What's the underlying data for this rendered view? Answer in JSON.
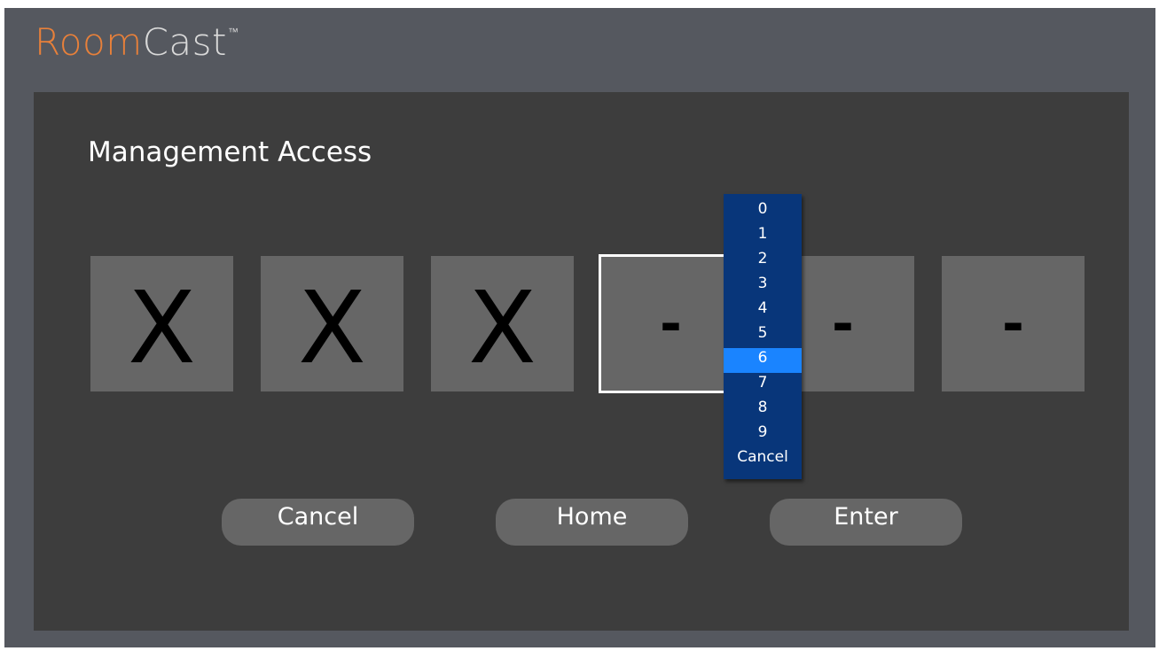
{
  "header": {
    "logo_part1": "Room",
    "logo_part2": "Cast",
    "logo_tm": "™"
  },
  "page": {
    "title": "Management Access"
  },
  "pin": {
    "slots": [
      "X",
      "X",
      "X",
      "-",
      "-",
      "-"
    ],
    "active_index": 3
  },
  "dropdown": {
    "options": [
      "0",
      "1",
      "2",
      "3",
      "4",
      "5",
      "6",
      "7",
      "8",
      "9",
      "Cancel"
    ],
    "highlighted": "6"
  },
  "buttons": {
    "cancel": "Cancel",
    "home": "Home",
    "enter": "Enter"
  },
  "colors": {
    "frame_bg": "#55585f",
    "panel_bg": "#3d3d3d",
    "slot_bg": "#666666",
    "logo_accent": "#e8803a",
    "dropdown_bg": "#08367a",
    "dropdown_highlight": "#1a84ff"
  }
}
